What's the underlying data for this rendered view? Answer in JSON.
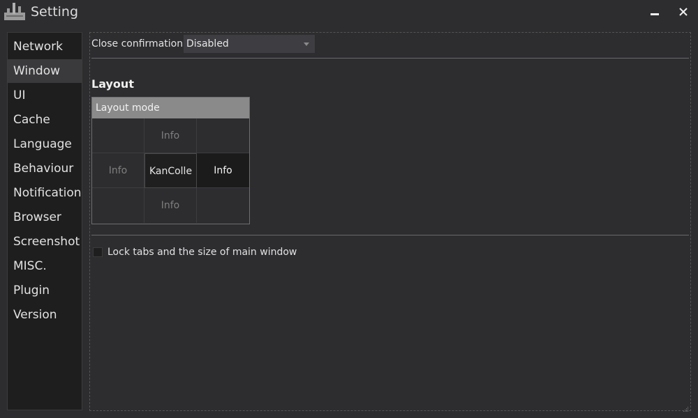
{
  "window": {
    "title": "Setting"
  },
  "sidebar": {
    "items": [
      {
        "label": "Network"
      },
      {
        "label": "Window",
        "selected": true
      },
      {
        "label": "UI"
      },
      {
        "label": "Cache"
      },
      {
        "label": "Language"
      },
      {
        "label": "Behaviour"
      },
      {
        "label": "Notification"
      },
      {
        "label": "Browser"
      },
      {
        "label": "Screenshot"
      },
      {
        "label": "MISC."
      },
      {
        "label": "Plugin"
      },
      {
        "label": "Version"
      }
    ]
  },
  "close_confirmation": {
    "label": "Close confirmation",
    "value": "Disabled"
  },
  "layout": {
    "section_title": "Layout",
    "header": "Layout mode",
    "grid": {
      "top": "Info",
      "left": "Info",
      "center": "KanColle",
      "right": "Info",
      "bottom": "Info"
    }
  },
  "lock_tabs": {
    "label": "Lock tabs and the size of main window",
    "checked": false
  },
  "colors": {
    "background": "#2d2d30",
    "sidebar": "#1e1e1e",
    "selected_item": "#3a3a3d",
    "layout_header": "#8a8a8a"
  }
}
